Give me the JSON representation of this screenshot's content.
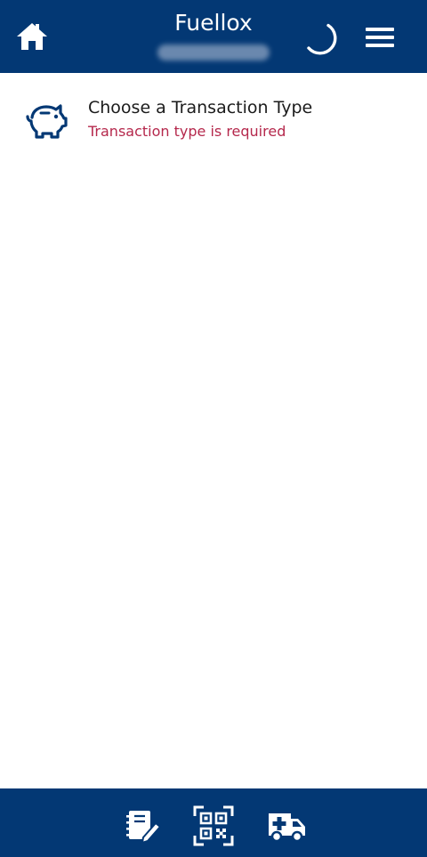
{
  "header": {
    "title": "Fuellox",
    "home_icon": "home-icon",
    "sync_icon": "loading-spinner-icon",
    "menu_icon": "hamburger-menu-icon"
  },
  "transaction": {
    "icon": "piggy-bank-icon",
    "title": "Choose a Transaction Type",
    "error": "Transaction type is required"
  },
  "bottom_nav": {
    "items": [
      {
        "icon": "edit-notes-icon"
      },
      {
        "icon": "qr-code-scan-icon"
      },
      {
        "icon": "ambulance-truck-icon"
      }
    ]
  },
  "colors": {
    "bar": "#033874",
    "error": "#b5284c",
    "text": "#1b1b1b",
    "icon": "#033874"
  }
}
